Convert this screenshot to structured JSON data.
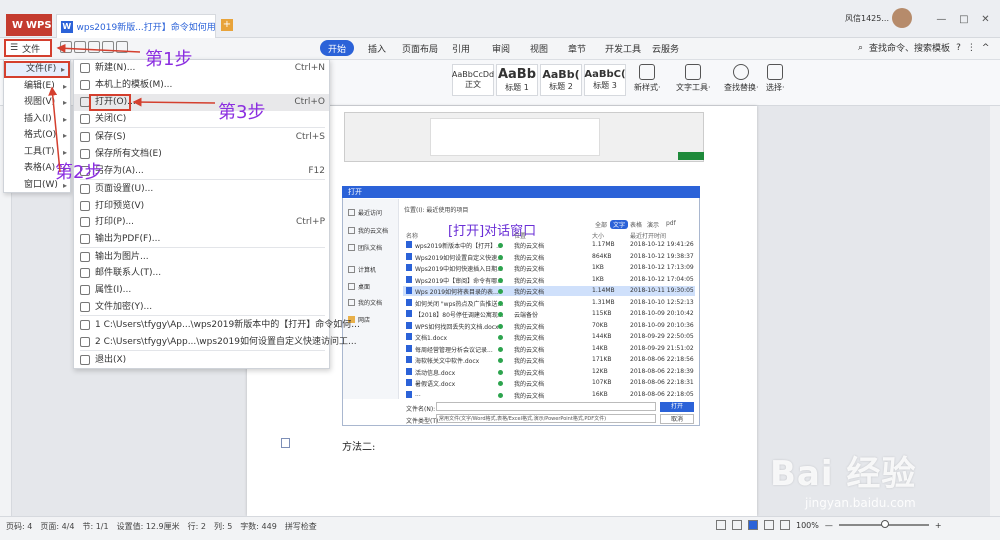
{
  "titlebar": {
    "app_tab": "WPS",
    "doc_tab": "wps2019新版...打开】命令如何用?",
    "add_tab": "+",
    "user": "风信1425...",
    "window_controls": [
      "—",
      "□",
      "✕"
    ]
  },
  "menubar": {
    "file_label": "文件",
    "tabs": [
      "开始",
      "插入",
      "页面布局",
      "引用",
      "审阅",
      "视图",
      "章节",
      "开发工具",
      "云服务"
    ],
    "search": "查找命令、搜索模板",
    "extra": [
      "?",
      "⋮",
      "^"
    ]
  },
  "ribbon": {
    "styles": [
      {
        "sample": "AaBbCcDd",
        "label": "正文"
      },
      {
        "sample": "AaBb",
        "label": "标题 1"
      },
      {
        "sample": "AaBb(",
        "label": "标题 2"
      },
      {
        "sample": "AaBbC(",
        "label": "标题 3"
      }
    ],
    "buttons": [
      "新样式·",
      "文字工具·",
      "查找替换·",
      "选择·"
    ]
  },
  "file_menu": {
    "items": [
      {
        "label": "文件(F)",
        "arrow": "▸"
      },
      {
        "label": "编辑(E)",
        "arrow": "▸"
      },
      {
        "label": "视图(V)",
        "arrow": "▸"
      },
      {
        "label": "插入(I)",
        "arrow": "▸"
      },
      {
        "label": "格式(O)",
        "arrow": "▸"
      },
      {
        "label": "工具(T)",
        "arrow": "▸"
      },
      {
        "label": "表格(A)",
        "arrow": "▸"
      },
      {
        "label": "窗口(W)",
        "arrow": "▸"
      }
    ]
  },
  "submenu": {
    "items": [
      {
        "label": "新建(N)...",
        "key": "Ctrl+N"
      },
      {
        "label": "本机上的模板(M)...",
        "key": ""
      },
      {
        "label": "打开(O)...",
        "key": "Ctrl+O"
      },
      {
        "label": "关闭(C)",
        "key": ""
      },
      {
        "label": "保存(S)",
        "key": "Ctrl+S"
      },
      {
        "label": "保存所有文档(E)",
        "key": ""
      },
      {
        "label": "另存为(A)...",
        "key": "F12"
      },
      {
        "label": "页面设置(U)...",
        "key": ""
      },
      {
        "label": "打印预览(V)",
        "key": ""
      },
      {
        "label": "打印(P)...",
        "key": "Ctrl+P"
      },
      {
        "label": "输出为PDF(F)...",
        "key": ""
      },
      {
        "label": "输出为图片...",
        "key": ""
      },
      {
        "label": "邮件联系人(T)...",
        "key": ""
      },
      {
        "label": "属性(I)...",
        "key": ""
      },
      {
        "label": "文件加密(Y)...",
        "key": ""
      },
      {
        "label": "1 C:\\Users\\tfygy\\Ap...\\wps2019新版本中的【打开】命令如何...",
        "key": ""
      },
      {
        "label": "2 C:\\Users\\tfygy\\App...\\wps2019如何设置自定义快速访问工...",
        "key": ""
      },
      {
        "label": "退出(X)",
        "key": ""
      }
    ]
  },
  "annotations": {
    "step1": "第1步",
    "step2": "第2步",
    "step3": "第3步"
  },
  "dialog": {
    "title": "打开",
    "location_label": "位置(I):",
    "location_value": "最近使用的项目",
    "caption": "[打开]对话窗口",
    "sidebar": [
      "最近访问",
      "我的云文档",
      "团队文档",
      "计算机",
      "桌面",
      "我的文档",
      "网店"
    ],
    "filters": [
      "全部",
      "文字",
      "表格",
      "演示",
      "pdf"
    ],
    "columns": [
      "名称",
      "位置",
      "大小",
      "最近打开时间"
    ],
    "files": [
      {
        "name": "wps2019新版本中的【打开】...",
        "loc": "我的云文档",
        "size": "1.17MB",
        "time": "2018-10-12 19:41:26"
      },
      {
        "name": "Wps2019如何设置自定义快速...",
        "loc": "我的云文档",
        "size": "864KB",
        "time": "2018-10-12 19:38:37"
      },
      {
        "name": "Wps2019中如何快速插入日期...",
        "loc": "我的云文档",
        "size": "1KB",
        "time": "2018-10-12 17:13:09"
      },
      {
        "name": "Wps2019中【审阅】命令有哪...",
        "loc": "我的云文档",
        "size": "1KB",
        "time": "2018-10-12 17:04:05"
      },
      {
        "name": "Wps 2019如何将表目录的表...",
        "loc": "我的云文档",
        "size": "1.14MB",
        "time": "2018-10-11 19:30:05"
      },
      {
        "name": "如何关闭 \"wps热点及广告推送...",
        "loc": "我的云文档",
        "size": "1.31MB",
        "time": "2018-10-10 12:52:13"
      },
      {
        "name": "【2018】80号停任调建公寓现...",
        "loc": "云端备份",
        "size": "115KB",
        "time": "2018-10-09 20:10:42"
      },
      {
        "name": "WPS如何找回丢失的文档.docx",
        "loc": "我的云文档",
        "size": "70KB",
        "time": "2018-10-09 20:10:36"
      },
      {
        "name": "文档1.docx",
        "loc": "我的云文档",
        "size": "144KB",
        "time": "2018-09-29 22:50:05"
      },
      {
        "name": "每周经营管理分析会议记录...",
        "loc": "我的云文档",
        "size": "14KB",
        "time": "2018-09-29 21:51:02"
      },
      {
        "name": "海软帐关文中软件.docx",
        "loc": "我的云文档",
        "size": "171KB",
        "time": "2018-08-06 22:18:56"
      },
      {
        "name": "活动信息.docx",
        "loc": "我的云文档",
        "size": "12KB",
        "time": "2018-08-06 22:18:39"
      },
      {
        "name": "暑假语文.docx",
        "loc": "我的云文档",
        "size": "107KB",
        "time": "2018-08-06 22:18:31"
      },
      {
        "name": "...",
        "loc": "我的云文档",
        "size": "16KB",
        "time": "2018-08-06 22:18:05"
      }
    ],
    "filename_label": "文件名(N):",
    "filetype_label": "文件类型(T):",
    "filetype_value": "常用文件(文字/Word格式,表格/Excel格式,演示/PowerPoint格式,PDF文件)",
    "open_btn": "打开",
    "cancel_btn": "取消"
  },
  "document": {
    "method2": "方法二:"
  },
  "statusbar": {
    "items": [
      "页码: 4",
      "页面: 4/4",
      "节: 1/1",
      "设置值: 12.9厘米",
      "行: 2",
      "列: 5",
      "字数: 449",
      "拼写检查"
    ],
    "zoom": "100%"
  },
  "watermark": {
    "brand": "Bai 经验",
    "url": "jingyan.baidu.com"
  }
}
